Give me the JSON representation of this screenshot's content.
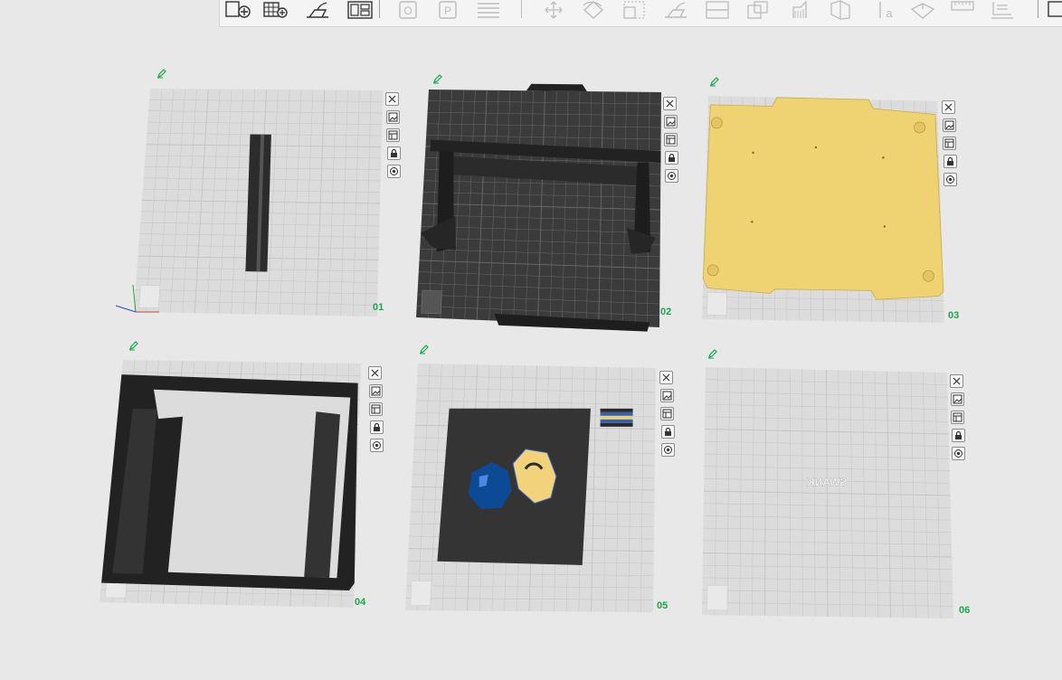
{
  "toolbar": {
    "buttons": [
      {
        "name": "add-object-button",
        "icon": "add-object-icon",
        "enabled": true
      },
      {
        "name": "add-plate-button",
        "icon": "add-plate-icon",
        "enabled": true
      },
      {
        "name": "auto-orient-button",
        "icon": "orient-icon",
        "enabled": true
      },
      {
        "name": "arrange-button",
        "icon": "arrange-icon",
        "enabled": true
      },
      {
        "name": "split-objects-button",
        "icon": "split-objects-icon",
        "enabled": false
      },
      {
        "name": "split-parts-button",
        "icon": "split-parts-icon",
        "enabled": false
      },
      {
        "name": "layers-button",
        "icon": "layers-icon",
        "enabled": false
      },
      {
        "name": "move-button",
        "icon": "move-icon",
        "enabled": false
      },
      {
        "name": "rotate-button",
        "icon": "rotate-icon",
        "enabled": false
      },
      {
        "name": "scale-button",
        "icon": "scale-icon",
        "enabled": false
      },
      {
        "name": "lay-on-face-button",
        "icon": "lay-on-face-icon",
        "enabled": false
      },
      {
        "name": "cut-button",
        "icon": "cut-icon",
        "enabled": false
      },
      {
        "name": "boolean-button",
        "icon": "boolean-icon",
        "enabled": false
      },
      {
        "name": "support-paint-button",
        "icon": "support-paint-icon",
        "enabled": false
      },
      {
        "name": "seam-paint-button",
        "icon": "seam-paint-icon",
        "enabled": false
      },
      {
        "name": "text-button",
        "icon": "text-icon",
        "enabled": false
      },
      {
        "name": "color-paint-button",
        "icon": "color-paint-icon",
        "enabled": false
      },
      {
        "name": "measure-button",
        "icon": "measure-icon",
        "enabled": false
      },
      {
        "name": "assembly-button",
        "icon": "assembly-icon",
        "enabled": false
      }
    ]
  },
  "plates": [
    {
      "number": "01",
      "content": "vertical-bar-model",
      "thumbnail": "light"
    },
    {
      "number": "02",
      "content": "dark-build-plate-with-stand",
      "thumbnail": "dark"
    },
    {
      "number": "03",
      "content": "yellow-panel-model",
      "thumbnail": "light"
    },
    {
      "number": "04",
      "content": "black-frame-model",
      "thumbnail": "light"
    },
    {
      "number": "05",
      "content": "dark-panel-with-blue-yellow-shapes",
      "thumbnail": "light"
    },
    {
      "number": "06",
      "content": "mirrored-text-model",
      "thumbnail": "light"
    }
  ],
  "plate_buttons": [
    "close-plate",
    "auto-orient-plate",
    "arrange-plate",
    "lock-plate",
    "plate-settings"
  ],
  "colors": {
    "plate_bg": "#dcdcdc",
    "grid_line": "#c4c4c4",
    "dark_plate": "#3b3b3b",
    "plate_number": "#17a84a",
    "edit_icon": "#17a84a",
    "model_black": "#2c2c2c",
    "model_yellow": "#efd272",
    "model_blue": "#0d4a96",
    "model_light_yellow": "#f2d27a"
  },
  "mirrored_text": "SWANK"
}
